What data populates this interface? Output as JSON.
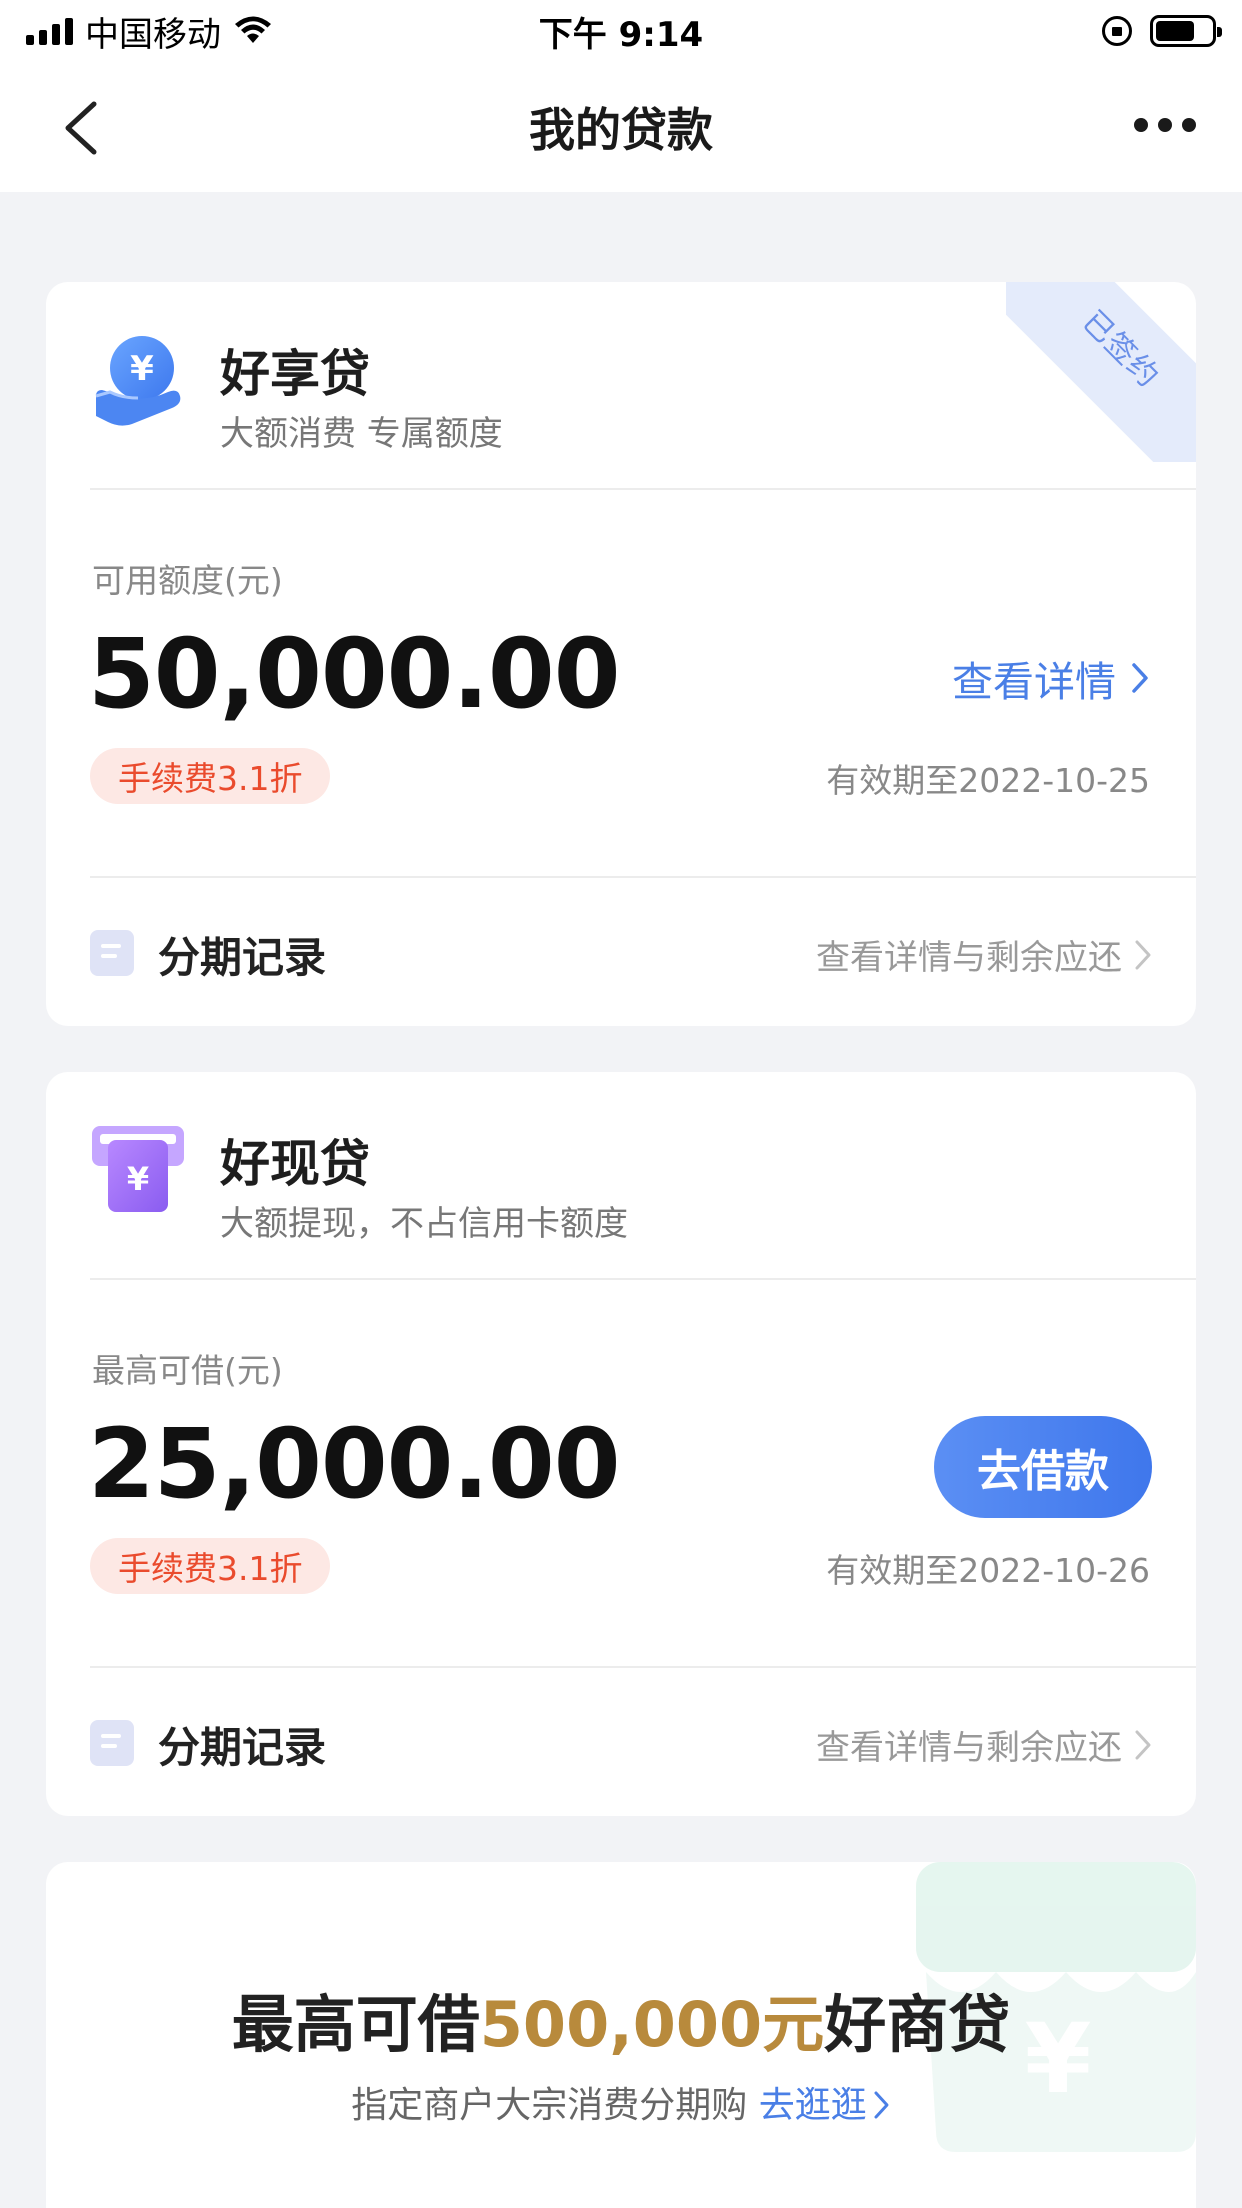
{
  "status_bar": {
    "carrier": "中国移动",
    "time": "下午 9:14"
  },
  "nav": {
    "title": "我的贷款"
  },
  "loans": [
    {
      "name": "好享贷",
      "subtitle": "大额消费 专属额度",
      "ribbon": "已签约",
      "amount_label": "可用额度(元)",
      "amount": "50,000.00",
      "fee_badge": "手续费3.1折",
      "expiry": "有效期至2022-10-25",
      "action": "查看详情",
      "record_label": "分期记录",
      "record_link": "查看详情与剩余应还",
      "icon": "hand-yuan-icon"
    },
    {
      "name": "好现贷",
      "subtitle": "大额提现，不占信用卡额度",
      "amount_label": "最高可借(元)",
      "amount": "25,000.00",
      "fee_badge": "手续费3.1折",
      "expiry": "有效期至2022-10-26",
      "action": "去借款",
      "record_label": "分期记录",
      "record_link": "查看详情与剩余应还",
      "icon": "atm-yuan-icon"
    }
  ],
  "promo": {
    "title_pre": "最高可借",
    "title_highlight": "500,000元",
    "title_post": "好商贷",
    "subtitle": "指定商户大宗消费分期购",
    "link": "去逛逛"
  },
  "colors": {
    "accent_blue": "#4a7fe6",
    "fee_red": "#ea4b2d",
    "gold": "#b88a3c",
    "background": "#f2f3f6"
  }
}
